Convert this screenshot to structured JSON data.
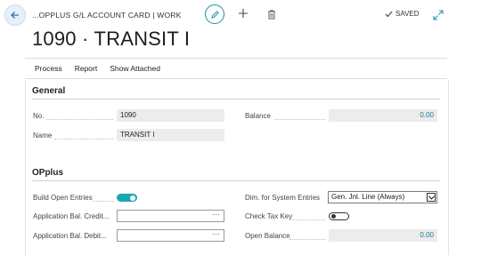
{
  "header": {
    "breadcrumb": "...OPPLUS G/L ACCOUNT CARD | WORK",
    "saved_label": "SAVED",
    "title": "1090 · TRANSIT I"
  },
  "menu": {
    "items": [
      "Process",
      "Report",
      "Show Attached"
    ]
  },
  "general": {
    "title": "General",
    "no_label": "No.",
    "no_value": "1090",
    "name_label": "Name",
    "name_value": "TRANSIT I",
    "balance_label": "Balance",
    "balance_value": "0.00"
  },
  "opplus": {
    "title": "OPplus",
    "build_open_entries_label": "Build Open Entries",
    "build_open_entries_on": true,
    "app_bal_credit_label": "Application Bal. Credit...",
    "app_bal_credit_value": "",
    "app_bal_debit_label": "Application Bal. Debit...",
    "app_bal_debit_value": "",
    "ellipsis": "···",
    "dim_label": "Dim. for System Entries",
    "dim_value": "Gen. Jnl. Line (Always)",
    "check_tax_key_label": "Check Tax Key",
    "check_tax_key_on": false,
    "open_balance_label": "Open Balance",
    "open_balance_value": "0.00"
  },
  "colors": {
    "accent": "#1ba6b1",
    "link_number": "#1d7aa0"
  },
  "icons": [
    "back-arrow-icon",
    "pencil-icon",
    "plus-icon",
    "trash-icon",
    "checkmark-icon",
    "expand-icon",
    "chevron-down-icon"
  ]
}
